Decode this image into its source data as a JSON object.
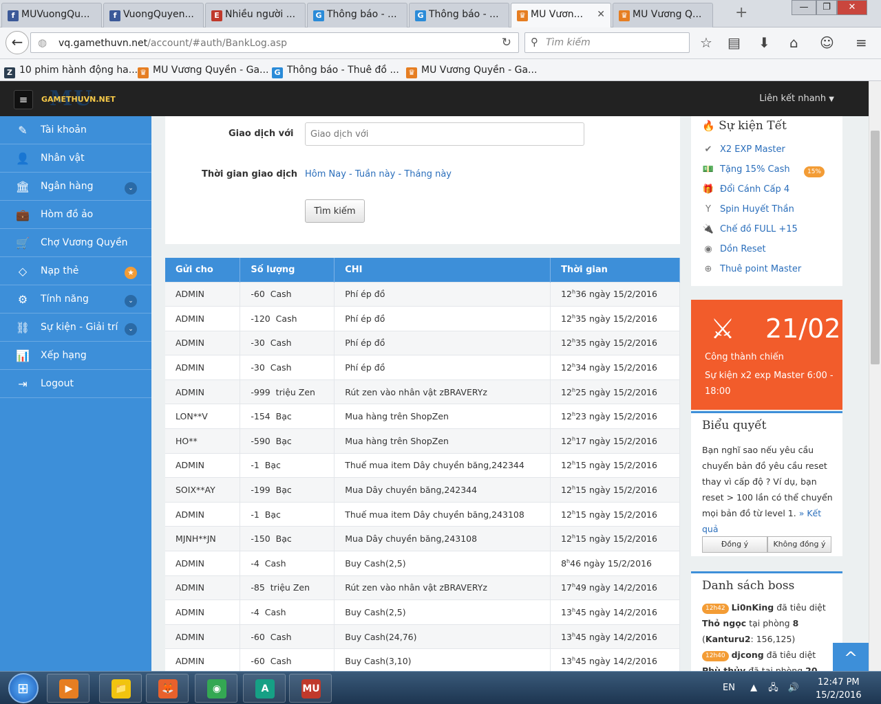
{
  "browser": {
    "tabs": [
      {
        "title": "MUVuongQu...",
        "icon": "facebook-icon",
        "color": "#3b5998",
        "glyph": "f"
      },
      {
        "title": "VuongQuyen...",
        "icon": "facebook-icon",
        "color": "#3b5998",
        "glyph": "f"
      },
      {
        "title": "Nhiều người ...",
        "icon": "site-e-icon",
        "color": "#c0392b",
        "glyph": "E"
      },
      {
        "title": "Thông báo - ...",
        "icon": "gamethu-g-icon",
        "color": "#2a8bd8",
        "glyph": "G"
      },
      {
        "title": "Thông báo - ...",
        "icon": "gamethu-g-icon",
        "color": "#2a8bd8",
        "glyph": "G"
      },
      {
        "title": "MU Vươn...",
        "icon": "crown-icon",
        "color": "#e67e22",
        "glyph": "♛"
      },
      {
        "title": "MU Vương Q...",
        "icon": "crown-icon",
        "color": "#e67e22",
        "glyph": "♛"
      }
    ],
    "new_tab": "+",
    "url_host": "vq.gamethuvn.net",
    "url_path": "/account/#auth/BankLog.asp",
    "search_placeholder": "Tìm kiếm",
    "bookmarks": [
      {
        "title": "10 phim hành động ha...",
        "icon": "z-icon",
        "color": "#2c3e50",
        "glyph": "Z"
      },
      {
        "title": "MU Vương Quyền - Ga...",
        "icon": "crown-icon",
        "color": "#e67e22",
        "glyph": "♛"
      },
      {
        "title": "Thông báo - Thuê đồ ...",
        "icon": "gamethu-g-icon",
        "color": "#2a8bd8",
        "glyph": "G"
      },
      {
        "title": "MU Vương Quyền - Ga...",
        "icon": "crown-icon",
        "color": "#e67e22",
        "glyph": "♛"
      }
    ]
  },
  "site": {
    "logo_big": "MU",
    "logo_small": "GAMETHUVN.NET",
    "quick_link": "Liên kết nhanh",
    "sidebar": [
      {
        "label": "Tài khoản",
        "icon": "edit-icon",
        "glyph": "✎"
      },
      {
        "label": "Nhân vật",
        "icon": "user-icon",
        "glyph": "👤"
      },
      {
        "label": "Ngân hàng",
        "icon": "bank-icon",
        "glyph": "🏛",
        "dropdown": "⌄"
      },
      {
        "label": "Hòm đồ ảo",
        "icon": "briefcase-icon",
        "glyph": "💼"
      },
      {
        "label": "Chợ Vương Quyền",
        "icon": "cart-icon",
        "glyph": "🛒"
      },
      {
        "label": "Nạp thẻ",
        "icon": "diamond-icon",
        "glyph": "◇",
        "star": "★"
      },
      {
        "label": "Tính năng",
        "icon": "cogs-icon",
        "glyph": "⚙",
        "dropdown": "⌄"
      },
      {
        "label": "Sự kiện - Giải trí",
        "icon": "chain-icon",
        "glyph": "⛓",
        "dropdown": "⌄"
      },
      {
        "label": "Xếp hạng",
        "icon": "bar-chart-icon",
        "glyph": "📊"
      },
      {
        "label": "Logout",
        "icon": "logout-icon",
        "glyph": "⇥"
      }
    ],
    "form": {
      "partner_label": "Giao dịch với",
      "partner_placeholder": "Giao dịch với",
      "time_label": "Thời gian giao dịch",
      "time_today": "Hôm Nay",
      "time_week": "Tuần này",
      "time_month": "Tháng này",
      "separator": " - ",
      "search_button": "Tìm kiếm"
    },
    "table": {
      "headers": [
        "Gửi cho",
        "Số lượng",
        "CHI",
        "Thời gian"
      ],
      "rows": [
        {
          "to": "ADMIN",
          "amount": "-60  Cash",
          "desc": "Phí ép đồ",
          "hour": "12",
          "rest": "36 ngày 15/2/2016"
        },
        {
          "to": "ADMIN",
          "amount": "-120  Cash",
          "desc": "Phí ép đồ",
          "hour": "12",
          "rest": "35 ngày 15/2/2016"
        },
        {
          "to": "ADMIN",
          "amount": "-30  Cash",
          "desc": "Phí ép đồ",
          "hour": "12",
          "rest": "35 ngày 15/2/2016"
        },
        {
          "to": "ADMIN",
          "amount": "-30  Cash",
          "desc": "Phí ép đồ",
          "hour": "12",
          "rest": "34 ngày 15/2/2016"
        },
        {
          "to": "ADMIN",
          "amount": "-999  triệu Zen",
          "desc": "Rút zen vào nhân vật zBRAVERYz",
          "hour": "12",
          "rest": "25 ngày 15/2/2016"
        },
        {
          "to": "LON**V",
          "amount": "-154  Bạc",
          "desc": "Mua hàng trên ShopZen",
          "hour": "12",
          "rest": "23 ngày 15/2/2016"
        },
        {
          "to": "HO**",
          "amount": "-590  Bạc",
          "desc": "Mua hàng trên ShopZen",
          "hour": "12",
          "rest": "17 ngày 15/2/2016"
        },
        {
          "to": "ADMIN",
          "amount": "-1  Bạc",
          "desc": "Thuế mua item Dây chuyền băng,242344",
          "hour": "12",
          "rest": "15 ngày 15/2/2016"
        },
        {
          "to": "SOIX**AY",
          "amount": "-199  Bạc",
          "desc": "Mua Dây chuyền băng,242344",
          "hour": "12",
          "rest": "15 ngày 15/2/2016"
        },
        {
          "to": "ADMIN",
          "amount": "-1  Bạc",
          "desc": "Thuế mua item Dây chuyền băng,243108",
          "hour": "12",
          "rest": "15 ngày 15/2/2016"
        },
        {
          "to": "MJNH**JN",
          "amount": "-150  Bạc",
          "desc": "Mua Dây chuyền băng,243108",
          "hour": "12",
          "rest": "15 ngày 15/2/2016"
        },
        {
          "to": "ADMIN",
          "amount": "-4  Cash",
          "desc": "Buy Cash(2,5)",
          "hour": "8",
          "rest": "46 ngày 15/2/2016"
        },
        {
          "to": "ADMIN",
          "amount": "-85  triệu Zen",
          "desc": "Rút zen vào nhân vật zBRAVERYz",
          "hour": "17",
          "rest": "49 ngày 14/2/2016"
        },
        {
          "to": "ADMIN",
          "amount": "-4  Cash",
          "desc": "Buy Cash(2,5)",
          "hour": "13",
          "rest": "45 ngày 14/2/2016"
        },
        {
          "to": "ADMIN",
          "amount": "-60  Cash",
          "desc": "Buy Cash(24,76)",
          "hour": "13",
          "rest": "45 ngày 14/2/2016"
        },
        {
          "to": "ADMIN",
          "amount": "-60  Cash",
          "desc": "Buy Cash(3,10)",
          "hour": "13",
          "rest": "45 ngày 14/2/2016"
        }
      ]
    },
    "events": {
      "title": "Sự kiện Tết",
      "items": [
        {
          "label": "X2 EXP Master",
          "icon": "check-circle-icon",
          "glyph": "✔"
        },
        {
          "label": "Tặng 15% Cash",
          "icon": "money-icon",
          "glyph": "💵",
          "badge": "15%"
        },
        {
          "label": "Đổi Cánh Cấp 4",
          "icon": "gift-icon",
          "glyph": "🎁"
        },
        {
          "label": "Spin Huyết Thần",
          "icon": "spin-icon",
          "glyph": "Y"
        },
        {
          "label": "Chế đồ FULL +15",
          "icon": "plug-icon",
          "glyph": "🔌"
        },
        {
          "label": "Dồn Reset",
          "icon": "chrome-icon",
          "glyph": "◉"
        },
        {
          "label": "Thuê point Master",
          "icon": "plus-circle-icon",
          "glyph": "⊕"
        }
      ]
    },
    "countdown": {
      "date": "21/02",
      "line1": "Công thành chiến",
      "line2": "Sự kiện x2 exp Master 6:00 - 18:00"
    },
    "poll": {
      "title": "Biểu quyết",
      "text": "Bạn nghĩ sao nếu yêu cầu chuyển bản đồ yêu cầu reset thay vì cấp độ ? Ví dụ, bạn reset > 100 lần có thể chuyển mọi bản đồ từ level 1.",
      "result_link": "» Kết quả",
      "agree": "Đồng ý",
      "disagree": "Không đồng ý"
    },
    "boss": {
      "title": "Danh sách boss",
      "entries": [
        {
          "time": "12h42",
          "player": "Li0nKing",
          "verb": "đã tiêu diệt",
          "boss": "Thỏ ngọc",
          "room_text": "tại phòng",
          "room": "8",
          "map": "Kanturu2",
          "coords": ": 156,125)"
        },
        {
          "time": "12h40",
          "player": "djcong",
          "verb": "đã tiêu diệt",
          "boss": "Phù thủy",
          "room_text": "đã tại phòng",
          "room": "20",
          "map": "",
          "coords": ""
        }
      ]
    },
    "to_top": "^"
  },
  "taskbar": {
    "apps": [
      {
        "name": "media-player",
        "icon": "media-player-icon",
        "color": "#e67e22",
        "glyph": "▶"
      },
      {
        "name": "file-explorer",
        "icon": "folder-icon",
        "color": "#f1c40f",
        "glyph": "📁"
      },
      {
        "name": "firefox",
        "icon": "firefox-icon",
        "color": "#e8612c",
        "glyph": "🦊"
      },
      {
        "name": "chrome",
        "icon": "chrome-icon",
        "color": "#34a853",
        "glyph": "◉"
      },
      {
        "name": "app-a",
        "icon": "app-a-icon",
        "color": "#16a085",
        "glyph": "A"
      },
      {
        "name": "mu-game",
        "icon": "mu-game-icon",
        "color": "#c0392b",
        "glyph": "MU"
      }
    ],
    "lang": "EN",
    "time": "12:47 PM",
    "date": "15/2/2016"
  }
}
